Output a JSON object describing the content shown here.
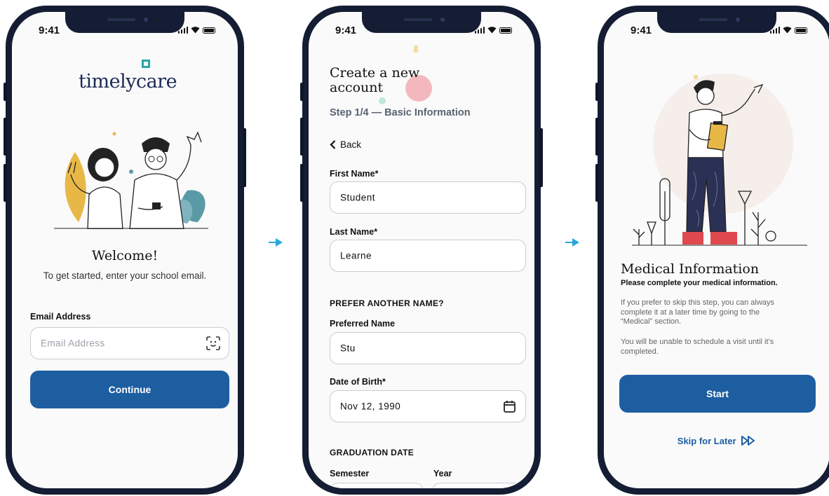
{
  "status_time": "9:41",
  "colors": {
    "brand_blue": "#1d5ea1",
    "accent_teal": "#2aa6a6",
    "phone_frame": "#141d33"
  },
  "screen1": {
    "logo_text": "timelycare",
    "welcome": "Welcome!",
    "subtitle": "To get started, enter your school email.",
    "email_label": "Email Address",
    "email_placeholder": "Email Address",
    "continue_label": "Continue"
  },
  "screen2": {
    "title_line1": "Create a new",
    "title_line2": "account",
    "step": "Step 1/4 — Basic Information",
    "back_label": "Back",
    "first_name_label": "First Name*",
    "first_name_value": "Student",
    "last_name_label": "Last Name*",
    "last_name_value": "Learne",
    "prefer_section": "PREFER ANOTHER NAME?",
    "preferred_label": "Preferred Name",
    "preferred_value": "Stu",
    "dob_label": "Date of Birth*",
    "dob_value": "Nov 12, 1990",
    "graduation_section": "GRADUATION DATE",
    "semester_label": "Semester",
    "year_label": "Year"
  },
  "screen3": {
    "title": "Medical Information",
    "subtitle": "Please complete your medical information.",
    "para1_line1": "If you prefer to skip this step, you can always",
    "para1_line2": "complete it at a later time by going to the",
    "para1_line3": "“Medical” section.",
    "para2_line1": "You will be unable to schedule a visit until it’s",
    "para2_line2": "completed.",
    "start_label": "Start",
    "skip_label": "Skip for Later"
  }
}
